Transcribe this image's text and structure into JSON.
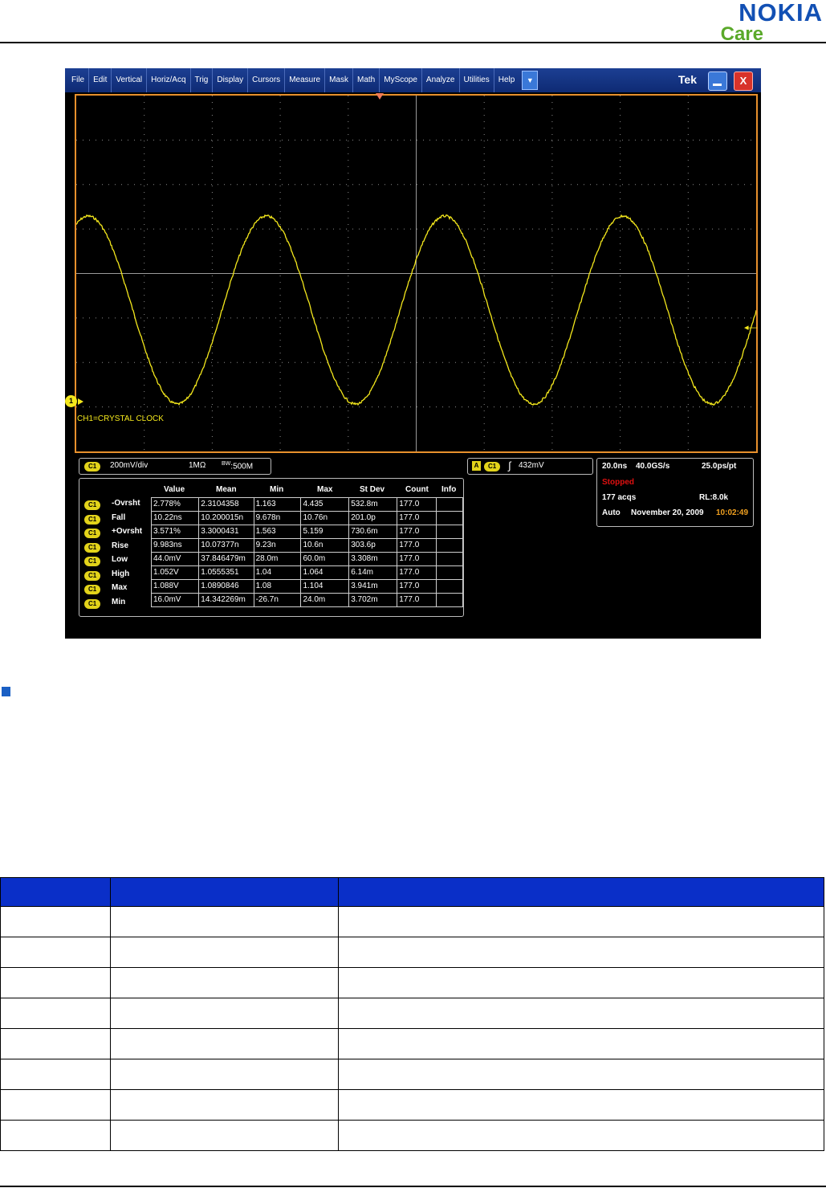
{
  "header": {
    "logo_text": "NOKIA",
    "logo_subtext": "Care"
  },
  "scope": {
    "menu": [
      "File",
      "Edit",
      "Vertical",
      "Horiz/Acq",
      "Trig",
      "Display",
      "Cursors",
      "Measure",
      "Mask",
      "Math",
      "MyScope",
      "Analyze",
      "Utilities",
      "Help"
    ],
    "menu_dropdown": "▼",
    "brand": "Tek",
    "close_label": "X",
    "channel_marker": "1",
    "channel_label": "CH1=CRYSTAL CLOCK",
    "vertical": {
      "channel": "C1",
      "scale": "200mV/div",
      "coupling": "1MΩ",
      "bw_label": "BW",
      "bw": "500M"
    },
    "trigger": {
      "source_letter": "A",
      "channel": "C1",
      "edge_symbol": "∫",
      "level": "432mV"
    },
    "horizontal": {
      "time_div": "20.0ns",
      "sample_rate": "40.0GS/s",
      "per_point": "25.0ps/pt",
      "state": "Stopped",
      "acqs": "177 acqs",
      "record_length": "RL:8.0k",
      "mode": "Auto",
      "date": "November 20, 2009",
      "time": "10:02:49"
    },
    "measurements": {
      "columns": [
        "Value",
        "Mean",
        "Min",
        "Max",
        "St Dev",
        "Count",
        "Info"
      ],
      "rows": [
        {
          "ch": "C1",
          "name": "-Ovrsht",
          "cells": [
            "2.778%",
            "2.3104358",
            "1.163",
            "4.435",
            "532.8m",
            "177.0",
            ""
          ]
        },
        {
          "ch": "C1",
          "name": "Fall",
          "cells": [
            "10.22ns",
            "10.200015n",
            "9.678n",
            "10.76n",
            "201.0p",
            "177.0",
            ""
          ]
        },
        {
          "ch": "C1",
          "name": "+Ovrsht",
          "cells": [
            "3.571%",
            "3.3000431",
            "1.563",
            "5.159",
            "730.6m",
            "177.0",
            ""
          ]
        },
        {
          "ch": "C1",
          "name": "Rise",
          "cells": [
            "9.983ns",
            "10.07377n",
            "9.23n",
            "10.6n",
            "303.6p",
            "177.0",
            ""
          ]
        },
        {
          "ch": "C1",
          "name": "Low",
          "cells": [
            "44.0mV",
            "37.846479m",
            "28.0m",
            "60.0m",
            "3.308m",
            "177.0",
            ""
          ]
        },
        {
          "ch": "C1",
          "name": "High",
          "cells": [
            "1.052V",
            "1.0555351",
            "1.04",
            "1.064",
            "6.14m",
            "177.0",
            ""
          ]
        },
        {
          "ch": "C1",
          "name": "Max",
          "cells": [
            "1.088V",
            "1.0890846",
            "1.08",
            "1.104",
            "3.941m",
            "177.0",
            ""
          ]
        },
        {
          "ch": "C1",
          "name": "Min",
          "cells": [
            "16.0mV",
            "14.342269m",
            "-26.7n",
            "24.0m",
            "3.702m",
            "177.0",
            ""
          ]
        }
      ]
    },
    "colors": {
      "trace": "#f4e81c",
      "frame": "#e8902c",
      "stopped": "#e01010",
      "time": "#f0a020"
    }
  }
}
